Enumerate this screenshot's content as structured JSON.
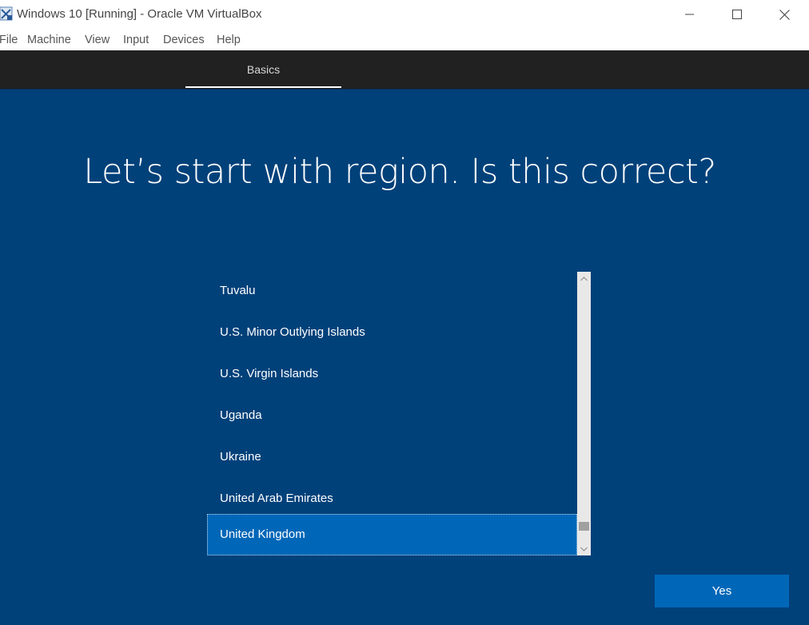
{
  "window": {
    "title": "Windows 10 [Running] - Oracle VM VirtualBox"
  },
  "menu": {
    "items": [
      "File",
      "Machine",
      "View",
      "Input",
      "Devices",
      "Help"
    ]
  },
  "tabs": {
    "active": "Basics"
  },
  "page": {
    "heading": "Let’s start with region. Is this correct?"
  },
  "regions": {
    "items": [
      "Tuvalu",
      "U.S. Minor Outlying Islands",
      "U.S. Virgin Islands",
      "Uganda",
      "Ukraine",
      "United Arab Emirates",
      "United Kingdom"
    ],
    "selected": "United Kingdom"
  },
  "actions": {
    "yes_label": "Yes"
  },
  "colors": {
    "oobe_background": "#01417a",
    "selected_item": "#0067b8",
    "button": "#0067b8",
    "tabbar": "#212121"
  }
}
